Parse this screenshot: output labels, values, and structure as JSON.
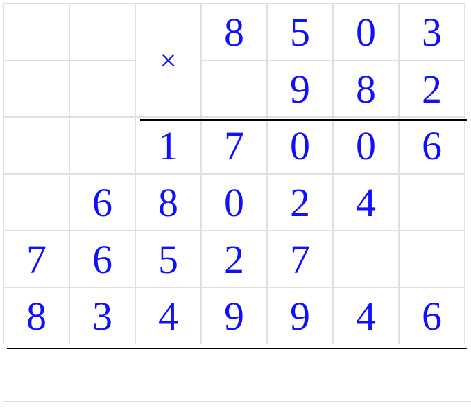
{
  "chart_data": {
    "type": "table",
    "description": "Long multiplication layout",
    "multiplicand": 8503,
    "multiplier": 982,
    "partial_products": [
      17006,
      68024,
      76527
    ],
    "product": 8349946
  },
  "symbols": {
    "times": "×"
  },
  "rows": [
    [
      "",
      "",
      "",
      "8",
      "5",
      "0",
      "3"
    ],
    [
      "",
      "",
      "",
      "",
      "9",
      "8",
      "2"
    ],
    [
      "",
      "",
      "1",
      "7",
      "0",
      "0",
      "6"
    ],
    [
      "",
      "6",
      "8",
      "0",
      "2",
      "4",
      ""
    ],
    [
      "7",
      "6",
      "5",
      "2",
      "7",
      "",
      ""
    ],
    [
      "8",
      "3",
      "4",
      "9",
      "9",
      "4",
      "6"
    ]
  ]
}
